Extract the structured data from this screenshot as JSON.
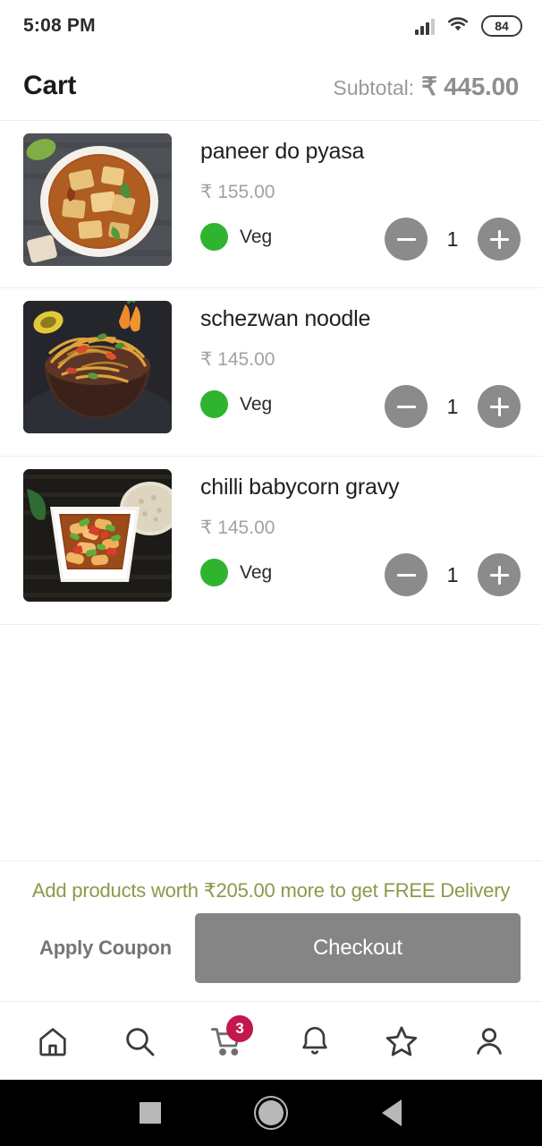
{
  "status_bar": {
    "time": "5:08 PM",
    "battery_level": "84",
    "signal_icon": "signal-bars-icon",
    "wifi_icon": "wifi-icon",
    "battery_icon": "battery-icon"
  },
  "header": {
    "title": "Cart",
    "subtotal_label": "Subtotal:",
    "subtotal_value": "₹ 445.00"
  },
  "cart_items": [
    {
      "name": "paneer do pyasa",
      "price": "₹ 155.00",
      "diet_label": "Veg",
      "quantity": "1",
      "image_alt": "paneer-curry-photo"
    },
    {
      "name": "schezwan noodle",
      "price": "₹ 145.00",
      "diet_label": "Veg",
      "quantity": "1",
      "image_alt": "schezwan-noodles-photo"
    },
    {
      "name": "chilli babycorn gravy",
      "price": "₹ 145.00",
      "diet_label": "Veg",
      "quantity": "1",
      "image_alt": "chilli-babycorn-photo"
    }
  ],
  "bottom_bar": {
    "promo_text": "Add products worth ₹205.00 more to get FREE Delivery",
    "apply_coupon_label": "Apply Coupon",
    "checkout_label": "Checkout"
  },
  "app_nav": {
    "items": [
      {
        "icon": "home-icon",
        "badge": ""
      },
      {
        "icon": "search-icon",
        "badge": ""
      },
      {
        "icon": "cart-icon",
        "badge": "3"
      },
      {
        "icon": "bell-icon",
        "badge": ""
      },
      {
        "icon": "star-icon",
        "badge": ""
      },
      {
        "icon": "person-icon",
        "badge": ""
      }
    ]
  },
  "system_nav": {
    "recents_icon": "square-recents-icon",
    "home_icon": "circle-home-icon",
    "back_icon": "triangle-back-icon"
  },
  "colors": {
    "veg_green": "#2fb42f",
    "promo_olive": "#8a9a4a",
    "badge_crimson": "#c2184b",
    "button_gray": "#858585",
    "stepper_gray": "#8b8b8b"
  }
}
